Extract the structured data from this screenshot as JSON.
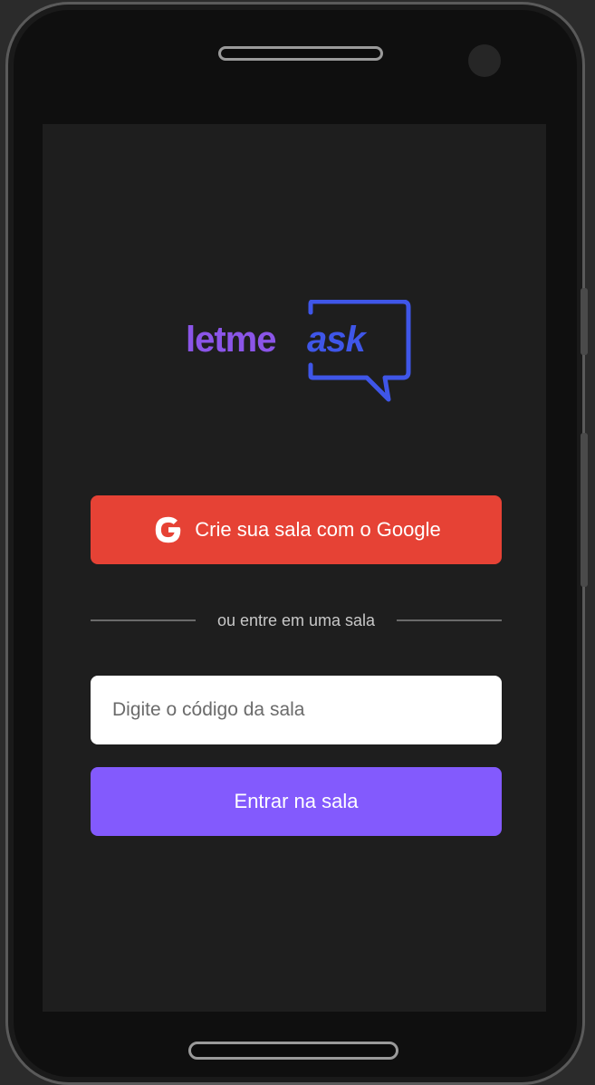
{
  "logo": {
    "part1": "letme",
    "part2": "ask",
    "colors": {
      "letme": "#8b55e8",
      "ask": "#3f56e8"
    }
  },
  "google_button": {
    "label": "Crie sua sala com o Google",
    "icon": "google-icon",
    "color": "#e64235"
  },
  "separator": {
    "label": "ou entre em uma sala"
  },
  "room_input": {
    "placeholder": "Digite o código da sala",
    "value": ""
  },
  "enter_button": {
    "label": "Entrar na sala",
    "color": "#835afd"
  }
}
